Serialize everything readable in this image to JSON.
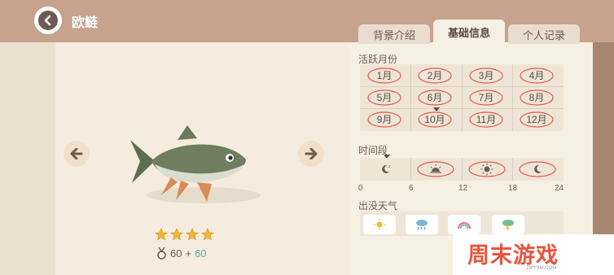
{
  "header": {
    "title": "欧鲢"
  },
  "tabs": [
    {
      "label": "背景介绍"
    },
    {
      "label": "基础信息",
      "active": true
    },
    {
      "label": "个人记录"
    }
  ],
  "active_months": {
    "label": "活跃月份",
    "months": [
      "1月",
      "2月",
      "3月",
      "4月",
      "5月",
      "6月",
      "7月",
      "8月",
      "9月",
      "10月",
      "11月",
      "12月"
    ],
    "current_month": "10月"
  },
  "time_period": {
    "label": "时间段",
    "slots": [
      {
        "icon": "moon-night-icon"
      },
      {
        "icon": "sunrise-icon"
      },
      {
        "icon": "sun-icon"
      },
      {
        "icon": "moon-icon"
      }
    ],
    "ticks": [
      "0",
      "6",
      "12",
      "18",
      "24"
    ]
  },
  "weather": {
    "label": "出没天气",
    "items": [
      {
        "icon": "sunny-icon"
      },
      {
        "icon": "rain-icon"
      },
      {
        "icon": "rainbow-icon"
      },
      {
        "icon": "thunderstorm-icon"
      }
    ]
  },
  "fish": {
    "stars": 4,
    "price": "60",
    "bonus": "60",
    "plus": "+"
  },
  "watermark": {
    "text": "周末游戏",
    "sub": "ZMYSM.COM"
  },
  "colors": {
    "accent_red": "#e05a4e",
    "bonus": "#3fb5b0",
    "star": "#f2b630"
  }
}
